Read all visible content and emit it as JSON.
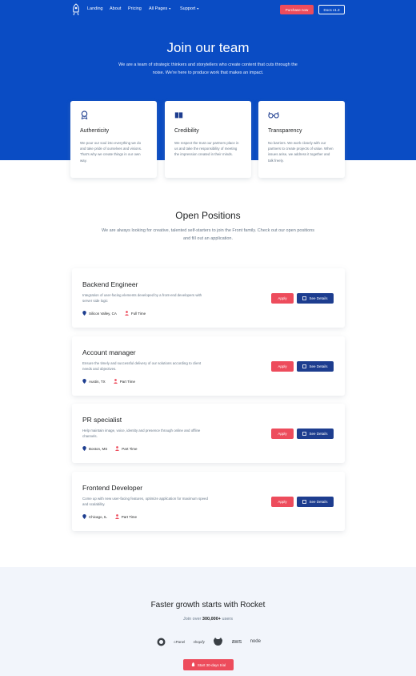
{
  "nav": {
    "links": [
      "Landing",
      "About",
      "Pricing",
      "All Pages",
      "Support"
    ],
    "purchase_label": "Purchase now",
    "docs_label": "Docs v1.3"
  },
  "hero": {
    "title": "Join our team",
    "subtitle": "We are a team of strategic thinkers and storytellers who create content that cuts through the noise. We're here to produce work that makes an impact."
  },
  "values": [
    {
      "icon": "badge-icon",
      "title": "Authenticity",
      "text": "We pour our soul into everything we do and take pride of ourselves and visions. That's why we create things in our own way."
    },
    {
      "icon": "book-icon",
      "title": "Credibility",
      "text": "We respect the trust our partners place in us and take the responsibility of meeting the impression created in their minds."
    },
    {
      "icon": "glasses-icon",
      "title": "Transparency",
      "text": "No barriers. We work closely with our partners to create projects of value. When issues arise, we address it together and talk freely."
    }
  ],
  "positions": {
    "title": "Open Positions",
    "subtitle": "We are always looking for creative, talented self-starters to join the Front family. Check out our open positions and fill out an application.",
    "apply_label": "Apply",
    "details_label": "See Details",
    "jobs": [
      {
        "title": "Backend Engineer",
        "description": "Integration of user-facing elements developed by a front-end developers with server side logic",
        "location": "Silicon Valley, CA",
        "type": "Full Time"
      },
      {
        "title": "Account manager",
        "description": "Ensure the timely and successful delivery of our solutions according to client needs and objectives.",
        "location": "Austin, TX",
        "type": "Part Time"
      },
      {
        "title": "PR specialist",
        "description": "Help maintain image, voice, identity and presence through online and offline channels.",
        "location": "Boston, MS",
        "type": "Part Time"
      },
      {
        "title": "Frontend Developer",
        "description": "Come up with new user-facing features, optimize application for maximum speed and scalability.",
        "location": "Chicago, IL",
        "type": "Part Time"
      }
    ]
  },
  "cta": {
    "title": "Faster growth starts with Rocket",
    "sub_prefix": "Join over",
    "sub_count": "300,000+",
    "sub_suffix": "users",
    "brands": [
      "mailchimp",
      "cPanel",
      "shopify",
      "github",
      "aws",
      "node"
    ],
    "trial_label": "Start 30-days trial"
  },
  "colors": {
    "primary": "#0a4cc4",
    "accent": "#ed4c5c",
    "dark_blue": "#1d3d8f"
  }
}
